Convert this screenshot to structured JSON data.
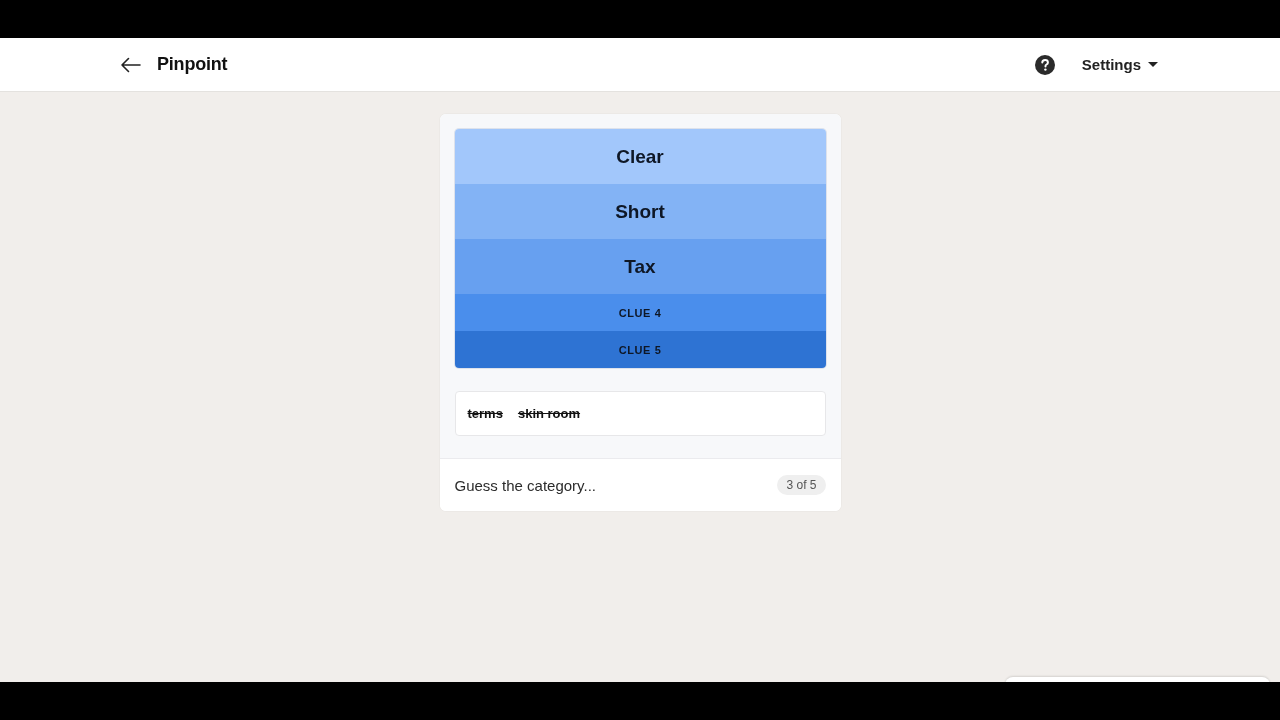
{
  "header": {
    "title": "Pinpoint",
    "settings_label": "Settings"
  },
  "clues": [
    {
      "kind": "revealed",
      "text": "Clear",
      "color": "#a2c7fb"
    },
    {
      "kind": "revealed",
      "text": "Short",
      "color": "#83b3f5"
    },
    {
      "kind": "revealed",
      "text": "Tax",
      "color": "#67a0f0"
    },
    {
      "kind": "hidden",
      "text": "CLUE 4",
      "color": "#4a8eec"
    },
    {
      "kind": "hidden",
      "text": "CLUE 5",
      "color": "#2e73d3"
    }
  ],
  "wrong_guesses": [
    "terms",
    "skin room"
  ],
  "guess_input": {
    "placeholder": "Guess the category...",
    "counter": "3 of 5"
  }
}
